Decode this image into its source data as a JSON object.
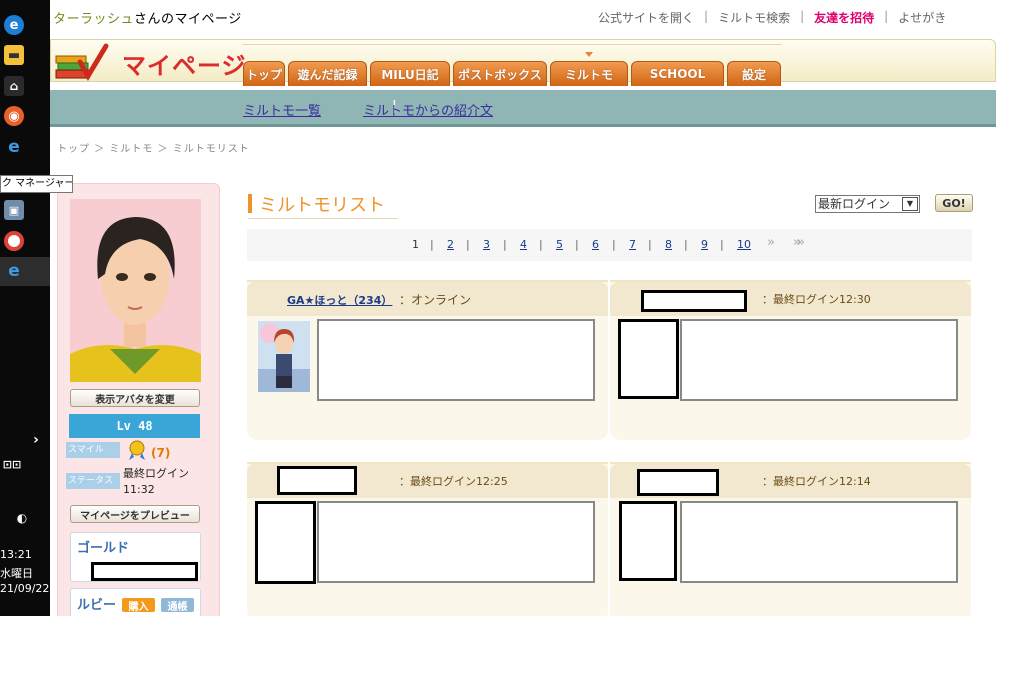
{
  "taskbar": {
    "tooltip": "ク マネージャー",
    "time": "13:21",
    "weekday": "水曜日",
    "date": "21/09/22"
  },
  "page_title": {
    "name": "ターラッシュ",
    "suffix": "さんのマイページ"
  },
  "top_links": {
    "official": "公式サイトを開く",
    "search": "ミルトモ検索",
    "invite": "友達を招待",
    "scribble": "よせがき"
  },
  "logo": {
    "text": "マイページ"
  },
  "tabs": [
    "トップ",
    "遊んだ記録",
    "MILU日記",
    "ポストボックス",
    "ミルトモ",
    "SCHOOL",
    "設定"
  ],
  "subnav": {
    "list": "ミルトモ一覧",
    "intro": "ミルトモからの紹介文"
  },
  "breadcrumb": "トップ ＞ ミルトモ ＞ ミルトモリスト",
  "sidebar": {
    "change_avatar": "表示アバタを変更",
    "level": "Lv 48",
    "smile_label": "スマイル",
    "smile_value": "(7)",
    "status_label": "ステータス",
    "status_value": "最終ログイン11:32",
    "preview": "マイページをプレビュー",
    "gold": "ゴールド",
    "ruby": "ルビー",
    "buy": "購入",
    "ledger": "通帳"
  },
  "list": {
    "title": "ミルトモリスト",
    "sort_value": "最新ログイン",
    "go": "GO!",
    "pages": [
      "1",
      "2",
      "3",
      "4",
      "5",
      "6",
      "7",
      "8",
      "9",
      "10"
    ],
    "next": "»",
    "last": "»»"
  },
  "friends": [
    {
      "name": "GA★ほっと（234）",
      "status": "：オンライン"
    },
    {
      "name": "",
      "status": "：最終ログイン12:30"
    },
    {
      "name": "",
      "status": "：最終ログイン12:25"
    },
    {
      "name": "",
      "status": "：最終ログイン12:14"
    }
  ],
  "colors": {
    "orange": "#f0932b",
    "teal": "#8fb5b5",
    "pink": "#e0006c",
    "link": "#1a3b8a"
  }
}
